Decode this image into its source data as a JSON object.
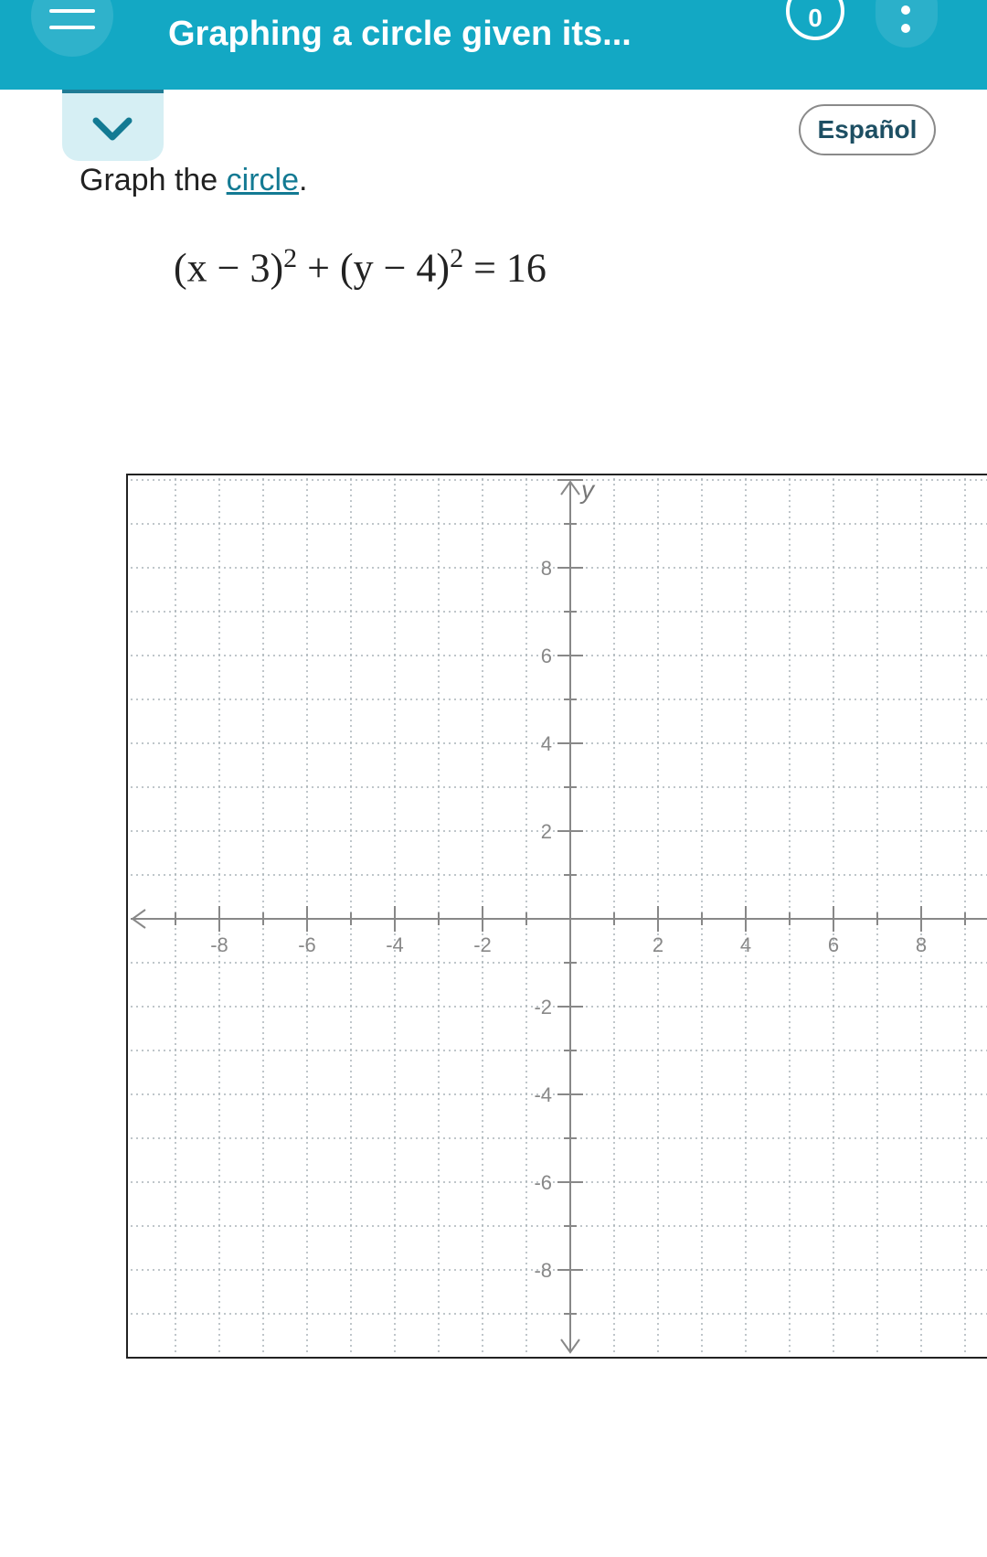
{
  "header": {
    "title": "Graphing a circle given its...",
    "score": "0",
    "background_color": "#13a8c4"
  },
  "toolbar": {
    "collapse_icon": "chevron-down-icon",
    "language_button": "Español"
  },
  "question": {
    "prompt_prefix": "Graph the ",
    "prompt_link": "circle",
    "prompt_suffix": ".",
    "equation": {
      "lhs_1": "(x − 3)",
      "exp_1": "2",
      "plus": " + ",
      "lhs_2": "(y − 4)",
      "exp_2": "2",
      "rhs": " = 16"
    }
  },
  "graph": {
    "y_axis_label": "y",
    "x_range": [
      -9.5,
      9.5
    ],
    "y_range": [
      -9.5,
      10
    ],
    "x_tick_labels": [
      "-8",
      "-6",
      "-4",
      "-2",
      "2",
      "4",
      "6",
      "8"
    ],
    "y_tick_labels": [
      "8",
      "6",
      "4",
      "2",
      "-2",
      "-4",
      "-6",
      "-8"
    ],
    "grid": true,
    "grid_style": "dotted"
  }
}
